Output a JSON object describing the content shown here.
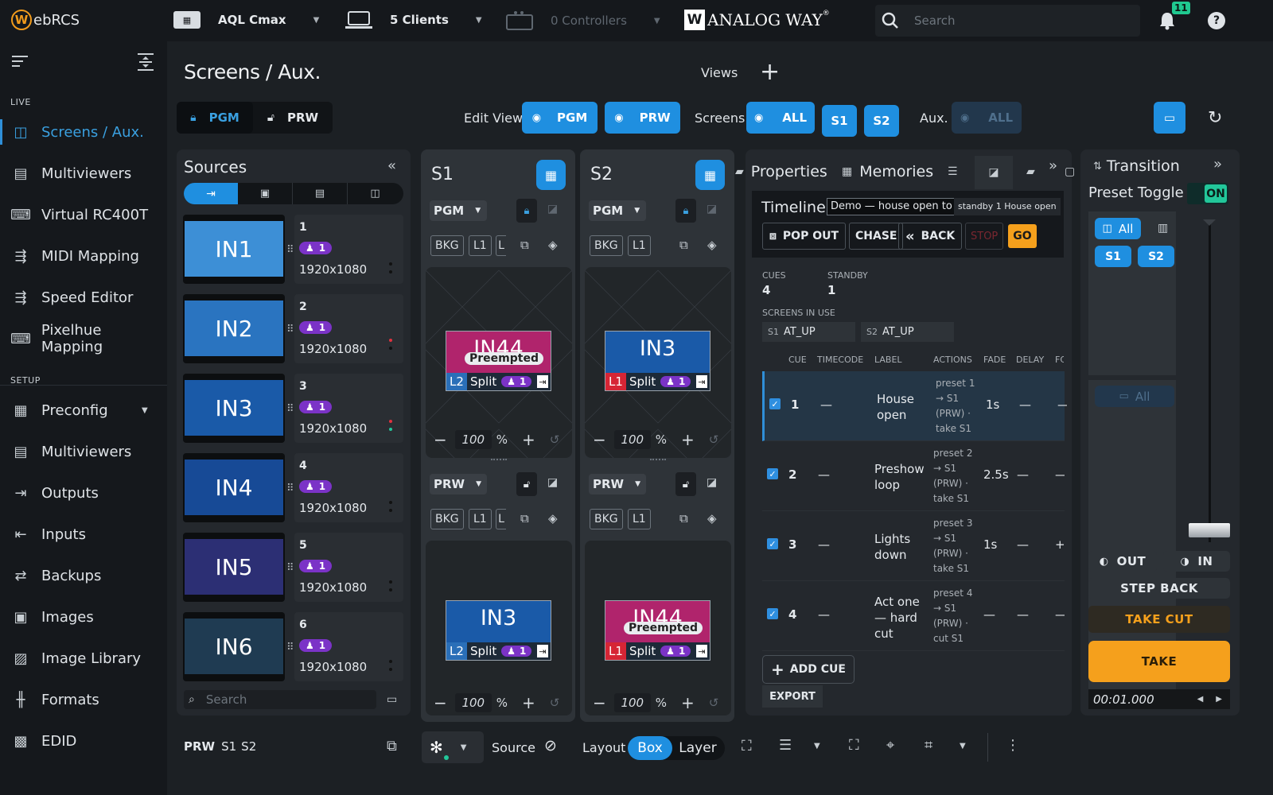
{
  "app": {
    "logo_w": "W",
    "logo_rest": "ebRCS",
    "brand": "ANALOG WAY",
    "brand_reg": "®"
  },
  "top": {
    "device": "AQL Cmax",
    "clients": "5 Clients",
    "controllers": "0 Controllers",
    "search_placeholder": "Search",
    "notif_count": "11"
  },
  "sidebar": {
    "live_label": "LIVE",
    "setup_label": "SETUP",
    "live_items": [
      {
        "label": "Screens / Aux.",
        "icon": "screens-icon"
      },
      {
        "label": "Multiviewers",
        "icon": "multiviewer-icon"
      },
      {
        "label": "Virtual RC400T",
        "icon": "keyboard-icon"
      },
      {
        "label": "MIDI Mapping",
        "icon": "midi-icon"
      },
      {
        "label": "Speed Editor",
        "icon": "speed-editor-icon"
      },
      {
        "label": "Pixelhue Mapping",
        "icon": "keyboard-icon"
      }
    ],
    "setup_items": [
      {
        "label": "Preconfig",
        "icon": "preconfig-icon"
      },
      {
        "label": "Multiviewers",
        "icon": "multiviewer-icon"
      },
      {
        "label": "Outputs",
        "icon": "outputs-icon"
      },
      {
        "label": "Inputs",
        "icon": "inputs-icon"
      },
      {
        "label": "Backups",
        "icon": "backups-icon"
      },
      {
        "label": "Images",
        "icon": "image-icon"
      },
      {
        "label": "Image Library",
        "icon": "image-library-icon"
      },
      {
        "label": "Formats",
        "icon": "formats-icon"
      },
      {
        "label": "EDID",
        "icon": "chip-icon"
      }
    ]
  },
  "header": {
    "title": "Screens / Aux.",
    "views": "Views",
    "pgm": "PGM",
    "prw": "PRW",
    "edit_view": "Edit View",
    "screens": "Screens",
    "all": "ALL",
    "s1": "S1",
    "s2": "S2",
    "aux": "Aux."
  },
  "sources": {
    "title": "Sources",
    "search_placeholder": "Search",
    "items": [
      {
        "label": "IN1",
        "num": "1",
        "badge": "1",
        "res": "1920x1080",
        "color": "#3d8fd6"
      },
      {
        "label": "IN2",
        "num": "2",
        "badge": "1",
        "res": "1920x1080",
        "color": "#2a74c0"
      },
      {
        "label": "IN3",
        "num": "3",
        "badge": "1",
        "res": "1920x1080",
        "color": "#1a5aa8"
      },
      {
        "label": "IN4",
        "num": "4",
        "badge": "1",
        "res": "1920x1080",
        "color": "#174a96"
      },
      {
        "label": "IN5",
        "num": "5",
        "badge": "1",
        "res": "1920x1080",
        "color": "#2c2f74"
      },
      {
        "label": "IN6",
        "num": "6",
        "badge": "1",
        "res": "1920x1080",
        "color": "#1f3b52"
      }
    ]
  },
  "screens": {
    "s1": {
      "title": "S1",
      "pgm": "PGM",
      "prw": "PRW"
    },
    "s2": {
      "title": "S2",
      "pgm": "PGM",
      "prw": "PRW"
    },
    "bkg": "BKG",
    "l1": "L1",
    "l_trunc": "L",
    "preempted": "Preempted",
    "split": "Split",
    "in44": "IN44",
    "in3": "IN3",
    "l1tag": "L1",
    "l2tag": "L2",
    "badge": "1",
    "zoom": "100",
    "pct": "%"
  },
  "props": {
    "tab_properties": "Properties",
    "tab_memories": "Memories",
    "timeline": "Timeline",
    "timeline_name": "Demo — house open to",
    "standby_tag": "standby 1 House open",
    "pop_out": "POP OUT",
    "chase": "CHASE",
    "back": "BACK",
    "stop": "STOP",
    "go": "GO",
    "cues_label": "CUES",
    "cues_val": "4",
    "standby_label": "STANDBY",
    "standby_val": "1",
    "screens_in_use": "SCREENS IN USE",
    "s1_tag": "S1",
    "s1_val": "AT_UP",
    "s2_tag": "S2",
    "s2_val": "AT_UP",
    "cols": {
      "cue": "CUE",
      "timecode": "TIMECODE",
      "label": "LABEL",
      "actions": "ACTIONS",
      "fade": "FADE",
      "delay": "DELAY",
      "fo": "FC"
    },
    "cues": [
      {
        "n": "1",
        "tc": "—",
        "label": "House open",
        "actions": "preset 1 → S1 (PRW) · take S1",
        "fade": "1s",
        "delay": "—",
        "fo": "—"
      },
      {
        "n": "2",
        "tc": "—",
        "label": "Preshow loop",
        "actions": "preset 2 → S1 (PRW) · take S1",
        "fade": "2.5s",
        "delay": "—",
        "fo": "—"
      },
      {
        "n": "3",
        "tc": "—",
        "label": "Lights down",
        "actions": "preset 3 → S1 (PRW) · take S1",
        "fade": "1s",
        "delay": "—",
        "fo": "+:"
      },
      {
        "n": "4",
        "tc": "—",
        "label": "Act one — hard cut",
        "actions": "preset 4 → S1 (PRW) · cut S1",
        "fade": "—",
        "delay": "—",
        "fo": "—"
      }
    ],
    "add_cue": "ADD CUE",
    "export": "EXPORT"
  },
  "transition": {
    "title": "Transition",
    "preset_toggle": "Preset Toggle",
    "on": "ON",
    "all": "All",
    "s1": "S1",
    "s2": "S2",
    "aux_all": "All",
    "out": "OUT",
    "in": "IN",
    "step_back": "STEP BACK",
    "take_cut": "TAKE CUT",
    "take": "TAKE",
    "time": "00:01.000"
  },
  "bottom": {
    "prw": "PRW",
    "s1": "S1",
    "s2": "S2",
    "source": "Source",
    "layout": "Layout",
    "box": "Box",
    "layer": "Layer"
  },
  "colors": {
    "accent": "#1f8fe0",
    "orange": "#f5a01c",
    "purple": "#7b33c7",
    "magenta": "#b0246c",
    "red": "#d62535"
  }
}
